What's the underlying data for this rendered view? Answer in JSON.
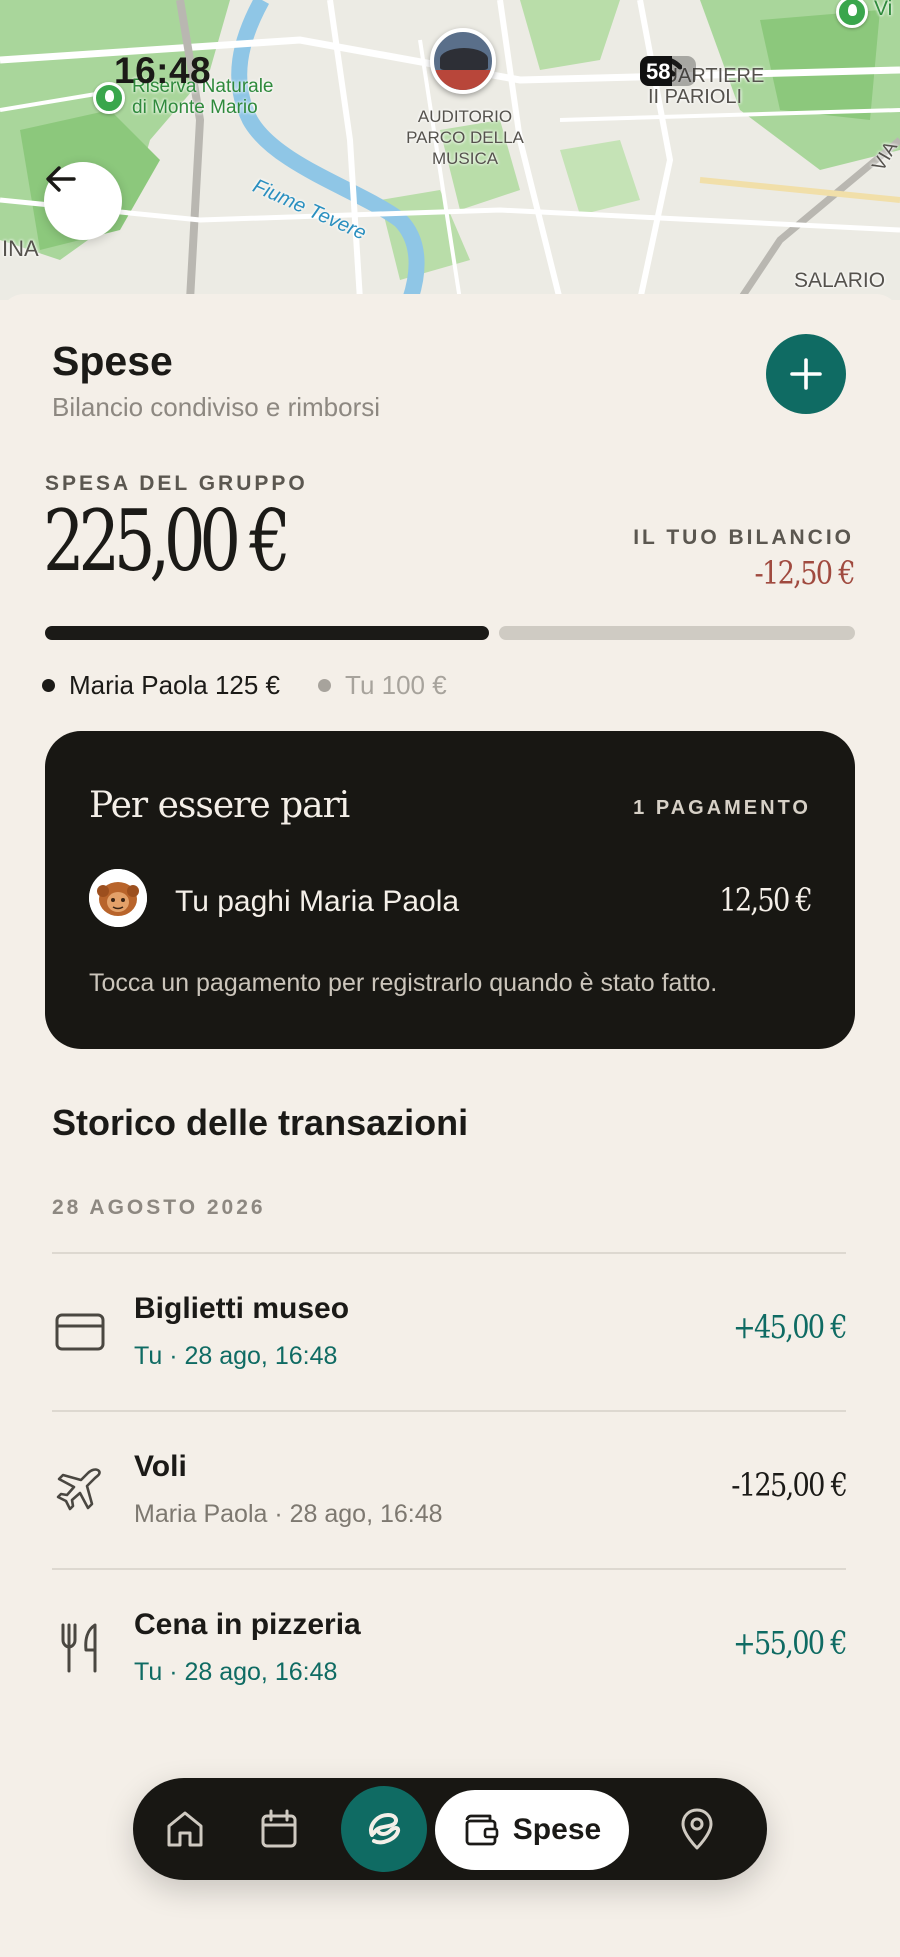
{
  "status_bar": {
    "time": "16:48",
    "battery": "58",
    "battery_level": 0.58
  },
  "map": {
    "labels": {
      "reserve": "Riserva Naturale\ndi Monte Mario",
      "auditorium": "AUDITORIO\nPARCO DELLA\nMUSICA",
      "quartiere": "QUARTIERE\nII PARIOLI",
      "river": "Fiume Tevere",
      "ina": "INA",
      "salario": "SALARIO",
      "via": "VIA",
      "vi": "Vi"
    }
  },
  "header": {
    "title": "Spese",
    "subtitle": "Bilancio condiviso e rimborsi"
  },
  "summary": {
    "group_label": "SPESA DEL GRUPPO",
    "group_total": "225,00 €",
    "balance_label": "IL TUO BILANCIO",
    "balance_value": "-12,50 €",
    "share_maria_paola": 125,
    "share_tu": 100,
    "legend": [
      {
        "label": "Maria Paola 125 €",
        "color": "#1b1a17"
      },
      {
        "label": "Tu 100 €",
        "color": "#a7a39c"
      }
    ]
  },
  "settle": {
    "heading": "Per essere pari",
    "count": "1 PAGAMENTO",
    "payment_text": "Tu paghi Maria Paola",
    "payment_amount": "12,50 €",
    "hint": "Tocca un pagamento per registrarlo quando è stato fatto."
  },
  "history": {
    "title": "Storico delle transazioni",
    "date": "28 AGOSTO 2026",
    "transactions": [
      {
        "icon": "credit-card-icon",
        "name": "Biglietti museo",
        "meta": "Tu · 28 ago, 16:48",
        "amount": "+45,00 €"
      },
      {
        "icon": "airplane-icon",
        "name": "Voli",
        "meta": "Maria Paola · 28 ago, 16:48",
        "amount": "-125,00 €"
      },
      {
        "icon": "fork-knife-icon",
        "name": "Cena in pizzeria",
        "meta": "Tu · 28 ago, 16:48",
        "amount": "+55,00 €"
      }
    ]
  },
  "nav": {
    "active_label": "Spese",
    "items": [
      "home-icon",
      "calendar-icon",
      "app-logo-icon",
      "wallet-icon",
      "location-pin-icon"
    ]
  },
  "colors": {
    "accent": "#0f6b63",
    "negative": "#a04a3f",
    "dark_card": "#181713",
    "background": "#f4efe8"
  }
}
